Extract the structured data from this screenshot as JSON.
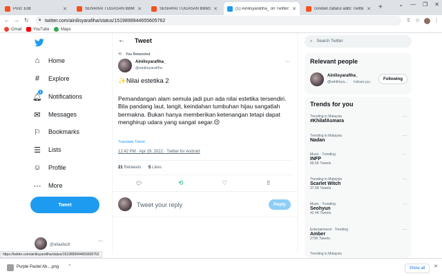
{
  "browser": {
    "tabs": [
      {
        "label": "Post: Edit",
        "favicon_color": "#f4511e"
      },
      {
        "label": "SENARAI TUGASAN BBM3410",
        "favicon_color": "#f4511e"
      },
      {
        "label": "SENARAI TUGASAN BBM3410",
        "favicon_color": "#f4511e"
      },
      {
        "label": "(1) Ainilisyarafiha_ on Twitter: \"",
        "favicon_color": "#1d9bf0"
      },
      {
        "label": "coretan zafarul adib: Twitter p",
        "favicon_color": "#f4511e"
      }
    ],
    "url": "twitter.com/ainilisyarafiha/status/1519899944655605762",
    "bookmarks": [
      {
        "label": "Gmail",
        "color": "#ea4335"
      },
      {
        "label": "YouTube",
        "color": "#ff0000"
      },
      {
        "label": "Maps",
        "color": "#34a853"
      }
    ],
    "status_url": "https://twitter.com/ainilisyarafiha/status/1519899944655605762",
    "download": {
      "filename": "Purple Pastel Ab....png",
      "show_all": "Show all"
    }
  },
  "nav": {
    "items": [
      {
        "label": "Home",
        "icon": "home-icon"
      },
      {
        "label": "Explore",
        "icon": "hash-icon"
      },
      {
        "label": "Notifications",
        "icon": "bell-icon",
        "badge": "1"
      },
      {
        "label": "Messages",
        "icon": "mail-icon"
      },
      {
        "label": "Bookmarks",
        "icon": "bookmark-icon"
      },
      {
        "label": "Lists",
        "icon": "list-icon"
      },
      {
        "label": "Profile",
        "icon": "user-icon"
      },
      {
        "label": "More",
        "icon": "more-icon"
      }
    ],
    "tweet_button": "Tweet",
    "account": {
      "handle": "@aliaafazli",
      "more": "···"
    }
  },
  "tweet": {
    "header": "Tweet",
    "retweeted": "You Retweeted",
    "author_name": "Ainilisyarafiha_",
    "author_handle": "@ainilisyarafiha",
    "title_line": "✨Nilai estetika 2",
    "body": "Pemandangan alam semula jadi pun ada nilai estetika tersendiri. Bila pandang laut, langit, keindahan tumbuhan hijau sangatlah bermakna. Bukan hanya memberikan ketenangan tetapi dapat menghirup udara yang sangat segar.😌",
    "translate": "Translate Tweet",
    "timestamp": "12:42 PM · Apr 29, 2022 · Twitter for Android",
    "retweets_count": "21",
    "retweets_label": "Retweets",
    "likes_count": "5",
    "likes_label": "Likes",
    "reply_placeholder": "Tweet your reply",
    "reply_button": "Reply"
  },
  "sidebar": {
    "search_placeholder": "Search Twitter",
    "relevant_title": "Relevant people",
    "person": {
      "name": "Ainilisyarafiha_",
      "handle": "@ainilisya...",
      "follows_you": "Follows you",
      "follow_button": "Following"
    },
    "trends_title": "Trends for you",
    "trends": [
      {
        "category": "Trending in Malaysia",
        "name": "#KhilafAsmara",
        "count": ""
      },
      {
        "category": "Trending in Malaysia",
        "name": "Nadan",
        "count": ""
      },
      {
        "category": "Music · Trending",
        "name": "INFP",
        "count": "89.5K Tweets"
      },
      {
        "category": "Trending in Malaysia",
        "name": "Scarlet Witch",
        "count": "37.5K Tweets"
      },
      {
        "category": "Music · Trending",
        "name": "Seohyun",
        "count": "42.4K Tweets"
      },
      {
        "category": "Entertainment · Trending",
        "name": "Amber",
        "count": "273K Tweets"
      },
      {
        "category": "Trending in Malaysia",
        "name": "",
        "count": ""
      }
    ]
  },
  "colors": {
    "accent": "#1d9bf0",
    "retweet_green": "#00ba7c"
  }
}
